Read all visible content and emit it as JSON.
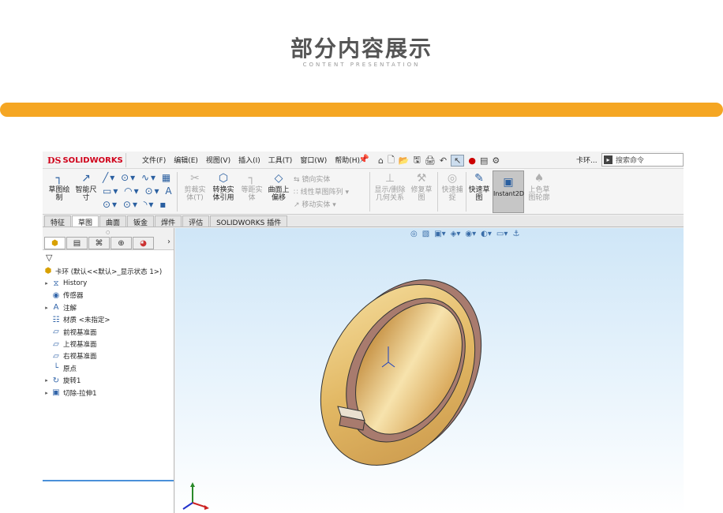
{
  "header": {
    "title": "部分内容展示",
    "subtitle": "CONTENT PRESENTATION"
  },
  "app": {
    "logo_ds": "DS",
    "logo_text": "SOLIDWORKS",
    "menu": [
      "文件(F)",
      "编辑(E)",
      "视图(V)",
      "插入(I)",
      "工具(T)",
      "窗口(W)",
      "帮助(H)"
    ],
    "doc_name": "卡环...",
    "search_placeholder": "搜索命令"
  },
  "ribbon": {
    "sketch": "草图绘\n制",
    "smart_dim": "智能尺\n寸",
    "trim": "剪裁实\n体(T)",
    "convert": "转换实\n体引用",
    "offset": "等距实\n体",
    "surface_offset": "曲面上\n偏移",
    "mirror": "镜向实体",
    "linear_pattern": "线性草图阵列",
    "move": "移动实体",
    "show_relations": "显示/删除\n几何关系",
    "repair": "修复草\n图",
    "quick_snap": "快速捕\n捉",
    "rapid_sketch": "快速草\n图",
    "instant2d": "Instant2D",
    "shaded": "上色草\n图轮廓"
  },
  "tabs": [
    "特征",
    "草图",
    "曲面",
    "钣金",
    "焊件",
    "评估",
    "SOLIDWORKS 插件"
  ],
  "active_tab": "草图",
  "tree": {
    "root": "卡环 (默认<<默认>_显示状态 1>)",
    "items": [
      {
        "label": "History",
        "icon": "history-icon",
        "expand": true
      },
      {
        "label": "传感器",
        "icon": "sensor-icon",
        "expand": false
      },
      {
        "label": "注解",
        "icon": "annotation-icon",
        "expand": true
      },
      {
        "label": "材质 <未指定>",
        "icon": "material-icon",
        "expand": false
      },
      {
        "label": "前视基准面",
        "icon": "plane-icon",
        "expand": false
      },
      {
        "label": "上视基准面",
        "icon": "plane-icon",
        "expand": false
      },
      {
        "label": "右视基准面",
        "icon": "plane-icon",
        "expand": false
      },
      {
        "label": "原点",
        "icon": "origin-icon",
        "expand": false
      },
      {
        "label": "旋转1",
        "icon": "revolve-icon",
        "expand": true
      },
      {
        "label": "切除-拉伸1",
        "icon": "cut-extrude-icon",
        "expand": true
      }
    ]
  },
  "colors": {
    "accent_bar": "#f5a623",
    "ring_face": "#e8c070",
    "ring_side": "#a87b6e"
  }
}
